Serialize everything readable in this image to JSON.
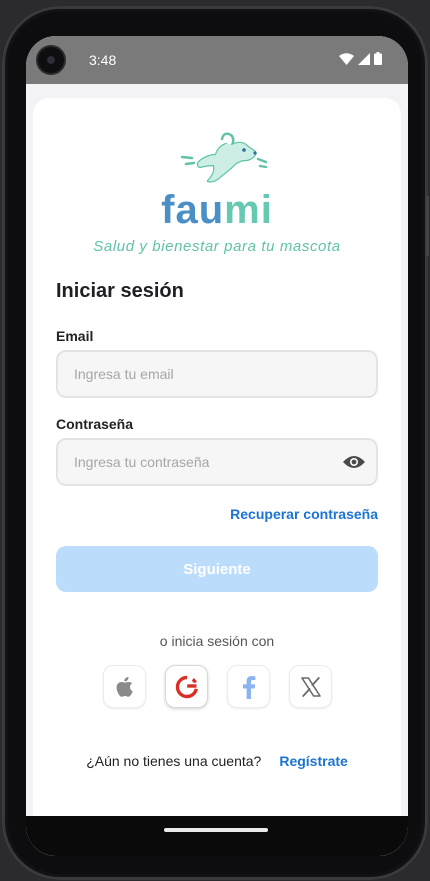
{
  "status_bar": {
    "time": "3:48",
    "icons": [
      "wifi-icon",
      "signal-icon",
      "battery-icon"
    ]
  },
  "brand": {
    "name_part1": "fau",
    "name_part2": "mi",
    "tagline": "Salud y bienestar para tu mascota",
    "colors": {
      "blue": "#4a8fc6",
      "mint": "#66c9b1"
    }
  },
  "login": {
    "title": "Iniciar sesión",
    "email_label": "Email",
    "email_value": "",
    "email_placeholder": "Ingresa tu email",
    "password_label": "Contraseña",
    "password_value": "",
    "password_placeholder": "Ingresa tu contraseña",
    "password_toggle_icon": "eye-icon",
    "recover_link": "Recuperar contraseña",
    "next_button": "Siguiente"
  },
  "social": {
    "prompt": "o inicia sesión con",
    "providers": [
      "apple-icon",
      "google-icon",
      "facebook-icon",
      "x-icon"
    ]
  },
  "signup": {
    "prompt": "¿Aún no tienes una cuenta?",
    "link": "Regístrate"
  },
  "colors": {
    "accent": "#1b74d4",
    "button_disabled": "#bcdcfc"
  }
}
